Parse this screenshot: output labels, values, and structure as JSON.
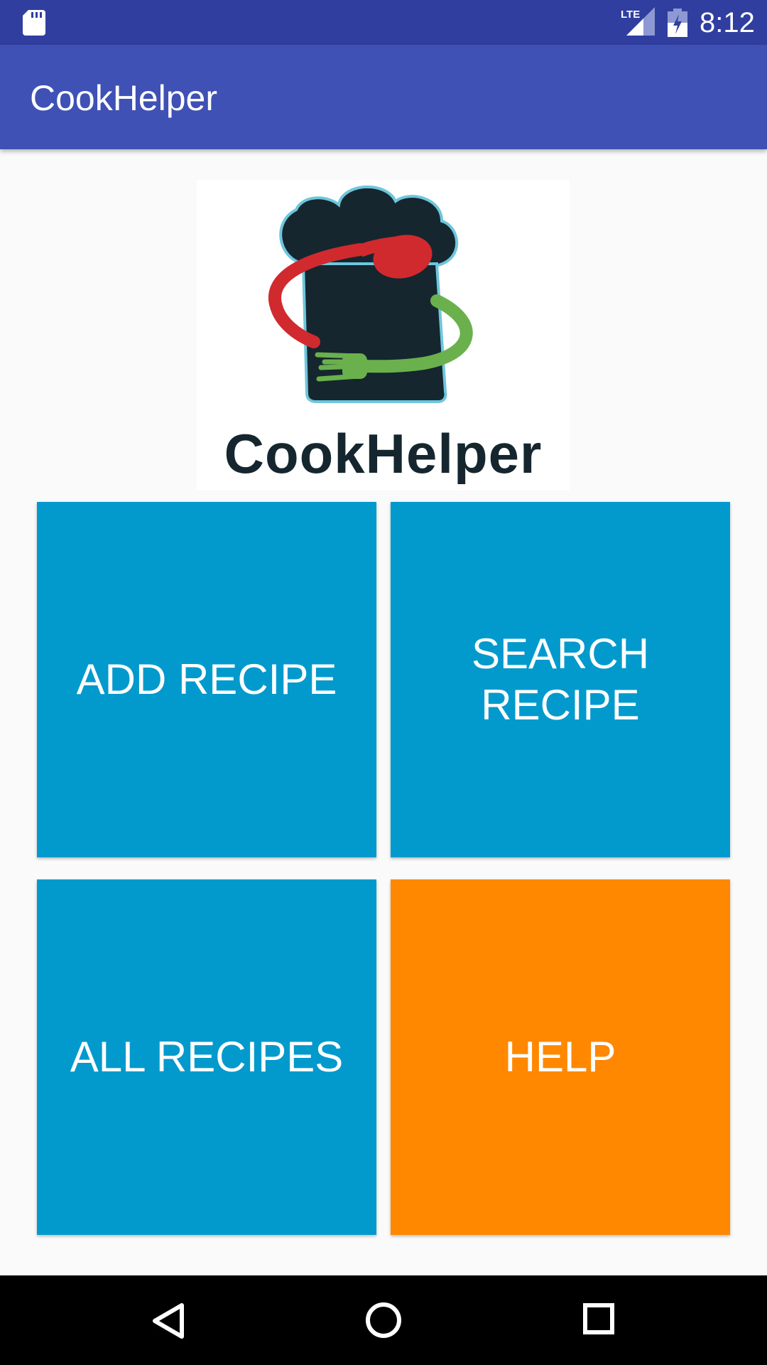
{
  "status_bar": {
    "time": "8:12",
    "network_label": "LTE",
    "icons": [
      "sd-card-icon",
      "lte-signal-icon",
      "battery-charging-icon"
    ]
  },
  "app_bar": {
    "title": "CookHelper"
  },
  "logo": {
    "wordmark": "CookHelper",
    "colors": {
      "hat": "#15262f",
      "hat_outline": "#6ec6dc",
      "spoon": "#d02a2f",
      "fork": "#6ab04c"
    }
  },
  "tiles": {
    "add_recipe": "ADD RECIPE",
    "search_recipe_line1": "SEARCH",
    "search_recipe_line2": "RECIPE",
    "all_recipes": "ALL RECIPES",
    "help": "HELP"
  },
  "colors": {
    "status_bar": "#303f9f",
    "app_bar": "#3f51b5",
    "tile_blue": "#0299cc",
    "tile_orange": "#ff8800",
    "background": "#fafafa"
  },
  "nav_bar": {
    "icons": [
      "back-icon",
      "home-icon",
      "recents-icon"
    ]
  }
}
